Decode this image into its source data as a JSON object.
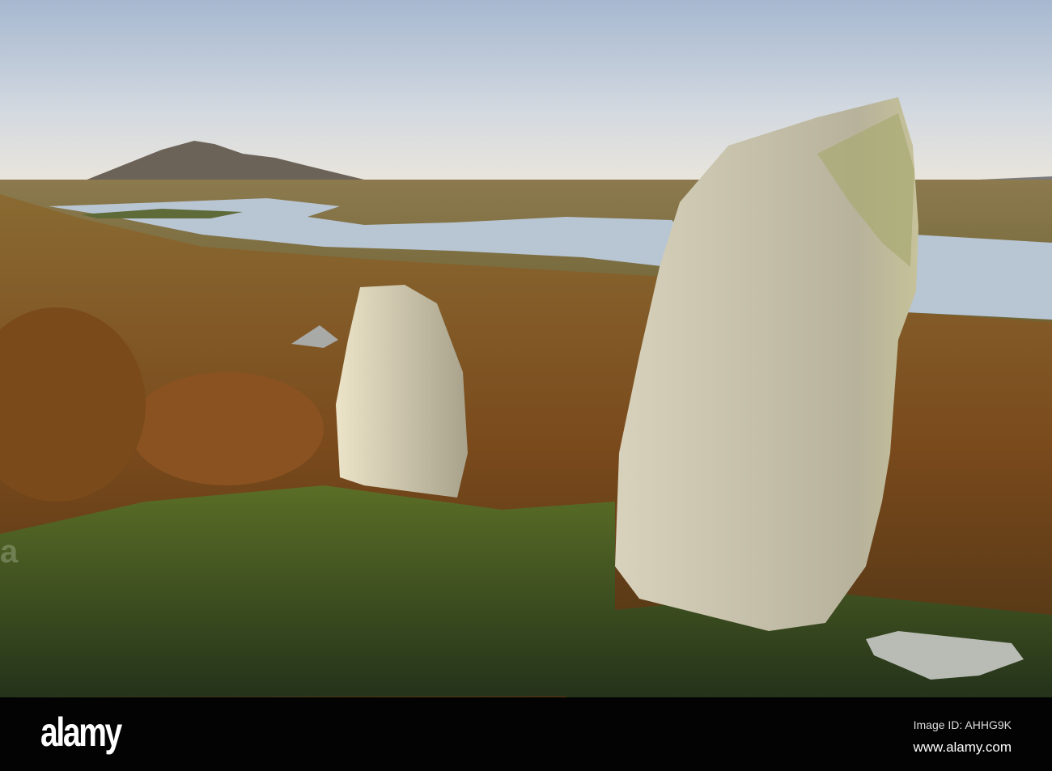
{
  "scene": {
    "description_colors": {
      "sky_top": "#9fb3cd",
      "sky_horizon": "#e8e6de",
      "loch": "#b9c6d4",
      "heather": "#8a5a22",
      "grass": "#3f5a1e",
      "stone": "#c9c2ad"
    }
  },
  "watermark": {
    "logo": "alamy",
    "image_id": "Image ID: AHHG9K",
    "site": "www.alamy.com"
  }
}
